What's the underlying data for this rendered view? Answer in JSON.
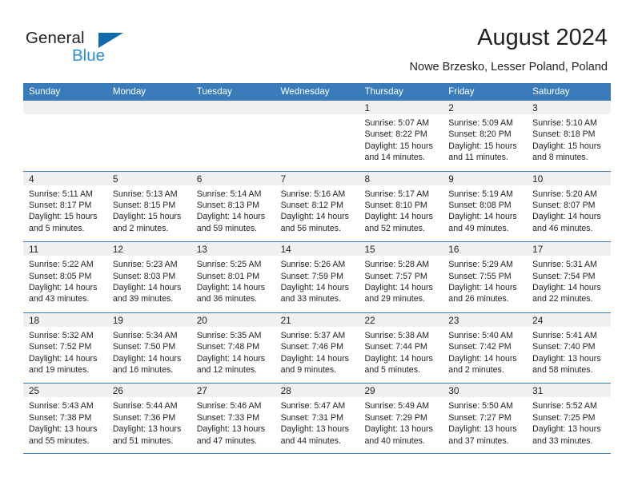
{
  "brand": {
    "name_dark": "General",
    "name_blue": "Blue",
    "triangle_icon": "triangle-logo-icon",
    "colors": {
      "dark": "#231f20",
      "blue_text": "#2a8fd4",
      "triangle": "#0f6ab0",
      "header_bar": "#3a7cba",
      "number_band": "#f0f0f0"
    }
  },
  "header": {
    "title": "August 2024",
    "subtitle": "Nowe Brzesko, Lesser Poland, Poland"
  },
  "calendar": {
    "weekdays": [
      "Sunday",
      "Monday",
      "Tuesday",
      "Wednesday",
      "Thursday",
      "Friday",
      "Saturday"
    ],
    "weeks": [
      [
        {
          "day": "",
          "lines": []
        },
        {
          "day": "",
          "lines": []
        },
        {
          "day": "",
          "lines": []
        },
        {
          "day": "",
          "lines": []
        },
        {
          "day": "1",
          "lines": [
            "Sunrise: 5:07 AM",
            "Sunset: 8:22 PM",
            "Daylight: 15 hours",
            "and 14 minutes."
          ]
        },
        {
          "day": "2",
          "lines": [
            "Sunrise: 5:09 AM",
            "Sunset: 8:20 PM",
            "Daylight: 15 hours",
            "and 11 minutes."
          ]
        },
        {
          "day": "3",
          "lines": [
            "Sunrise: 5:10 AM",
            "Sunset: 8:18 PM",
            "Daylight: 15 hours",
            "and 8 minutes."
          ]
        }
      ],
      [
        {
          "day": "4",
          "lines": [
            "Sunrise: 5:11 AM",
            "Sunset: 8:17 PM",
            "Daylight: 15 hours",
            "and 5 minutes."
          ]
        },
        {
          "day": "5",
          "lines": [
            "Sunrise: 5:13 AM",
            "Sunset: 8:15 PM",
            "Daylight: 15 hours",
            "and 2 minutes."
          ]
        },
        {
          "day": "6",
          "lines": [
            "Sunrise: 5:14 AM",
            "Sunset: 8:13 PM",
            "Daylight: 14 hours",
            "and 59 minutes."
          ]
        },
        {
          "day": "7",
          "lines": [
            "Sunrise: 5:16 AM",
            "Sunset: 8:12 PM",
            "Daylight: 14 hours",
            "and 56 minutes."
          ]
        },
        {
          "day": "8",
          "lines": [
            "Sunrise: 5:17 AM",
            "Sunset: 8:10 PM",
            "Daylight: 14 hours",
            "and 52 minutes."
          ]
        },
        {
          "day": "9",
          "lines": [
            "Sunrise: 5:19 AM",
            "Sunset: 8:08 PM",
            "Daylight: 14 hours",
            "and 49 minutes."
          ]
        },
        {
          "day": "10",
          "lines": [
            "Sunrise: 5:20 AM",
            "Sunset: 8:07 PM",
            "Daylight: 14 hours",
            "and 46 minutes."
          ]
        }
      ],
      [
        {
          "day": "11",
          "lines": [
            "Sunrise: 5:22 AM",
            "Sunset: 8:05 PM",
            "Daylight: 14 hours",
            "and 43 minutes."
          ]
        },
        {
          "day": "12",
          "lines": [
            "Sunrise: 5:23 AM",
            "Sunset: 8:03 PM",
            "Daylight: 14 hours",
            "and 39 minutes."
          ]
        },
        {
          "day": "13",
          "lines": [
            "Sunrise: 5:25 AM",
            "Sunset: 8:01 PM",
            "Daylight: 14 hours",
            "and 36 minutes."
          ]
        },
        {
          "day": "14",
          "lines": [
            "Sunrise: 5:26 AM",
            "Sunset: 7:59 PM",
            "Daylight: 14 hours",
            "and 33 minutes."
          ]
        },
        {
          "day": "15",
          "lines": [
            "Sunrise: 5:28 AM",
            "Sunset: 7:57 PM",
            "Daylight: 14 hours",
            "and 29 minutes."
          ]
        },
        {
          "day": "16",
          "lines": [
            "Sunrise: 5:29 AM",
            "Sunset: 7:55 PM",
            "Daylight: 14 hours",
            "and 26 minutes."
          ]
        },
        {
          "day": "17",
          "lines": [
            "Sunrise: 5:31 AM",
            "Sunset: 7:54 PM",
            "Daylight: 14 hours",
            "and 22 minutes."
          ]
        }
      ],
      [
        {
          "day": "18",
          "lines": [
            "Sunrise: 5:32 AM",
            "Sunset: 7:52 PM",
            "Daylight: 14 hours",
            "and 19 minutes."
          ]
        },
        {
          "day": "19",
          "lines": [
            "Sunrise: 5:34 AM",
            "Sunset: 7:50 PM",
            "Daylight: 14 hours",
            "and 16 minutes."
          ]
        },
        {
          "day": "20",
          "lines": [
            "Sunrise: 5:35 AM",
            "Sunset: 7:48 PM",
            "Daylight: 14 hours",
            "and 12 minutes."
          ]
        },
        {
          "day": "21",
          "lines": [
            "Sunrise: 5:37 AM",
            "Sunset: 7:46 PM",
            "Daylight: 14 hours",
            "and 9 minutes."
          ]
        },
        {
          "day": "22",
          "lines": [
            "Sunrise: 5:38 AM",
            "Sunset: 7:44 PM",
            "Daylight: 14 hours",
            "and 5 minutes."
          ]
        },
        {
          "day": "23",
          "lines": [
            "Sunrise: 5:40 AM",
            "Sunset: 7:42 PM",
            "Daylight: 14 hours",
            "and 2 minutes."
          ]
        },
        {
          "day": "24",
          "lines": [
            "Sunrise: 5:41 AM",
            "Sunset: 7:40 PM",
            "Daylight: 13 hours",
            "and 58 minutes."
          ]
        }
      ],
      [
        {
          "day": "25",
          "lines": [
            "Sunrise: 5:43 AM",
            "Sunset: 7:38 PM",
            "Daylight: 13 hours",
            "and 55 minutes."
          ]
        },
        {
          "day": "26",
          "lines": [
            "Sunrise: 5:44 AM",
            "Sunset: 7:36 PM",
            "Daylight: 13 hours",
            "and 51 minutes."
          ]
        },
        {
          "day": "27",
          "lines": [
            "Sunrise: 5:46 AM",
            "Sunset: 7:33 PM",
            "Daylight: 13 hours",
            "and 47 minutes."
          ]
        },
        {
          "day": "28",
          "lines": [
            "Sunrise: 5:47 AM",
            "Sunset: 7:31 PM",
            "Daylight: 13 hours",
            "and 44 minutes."
          ]
        },
        {
          "day": "29",
          "lines": [
            "Sunrise: 5:49 AM",
            "Sunset: 7:29 PM",
            "Daylight: 13 hours",
            "and 40 minutes."
          ]
        },
        {
          "day": "30",
          "lines": [
            "Sunrise: 5:50 AM",
            "Sunset: 7:27 PM",
            "Daylight: 13 hours",
            "and 37 minutes."
          ]
        },
        {
          "day": "31",
          "lines": [
            "Sunrise: 5:52 AM",
            "Sunset: 7:25 PM",
            "Daylight: 13 hours",
            "and 33 minutes."
          ]
        }
      ]
    ]
  }
}
